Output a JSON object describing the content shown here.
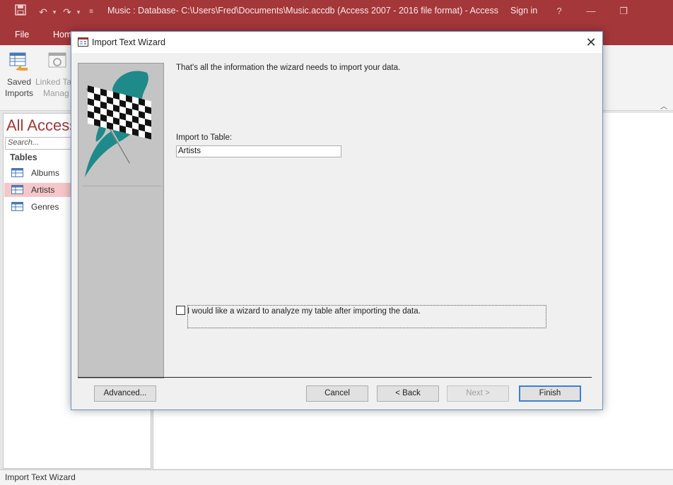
{
  "app": {
    "window_title": "Music : Database- C:\\Users\\Fred\\Documents\\Music.accdb (Access 2007 - 2016 file format) - Access",
    "sign_in": "Sign in",
    "help": "?",
    "brand_color": "#a4373a"
  },
  "ribbon": {
    "tabs": [
      "File",
      "Home"
    ],
    "saved_imports": "Saved\nImports",
    "saved_imports_l1": "Saved",
    "saved_imports_l2": "Imports",
    "linked_l1": "Linked Ta",
    "linked_l2": "Manag"
  },
  "nav": {
    "title": "All Access",
    "search_placeholder": "Search...",
    "group": "Tables",
    "items": [
      {
        "label": "Albums",
        "selected": false
      },
      {
        "label": "Artists",
        "selected": true
      },
      {
        "label": "Genres",
        "selected": false
      }
    ]
  },
  "status": {
    "text": "Import Text Wizard"
  },
  "dialog": {
    "title": "Import Text Wizard",
    "message": "That's all the information the wizard needs to import your data.",
    "import_label": "Import to Table:",
    "import_value": "Artists",
    "analyze_checkbox_label": "I would like a wizard to analyze my table after importing the data.",
    "analyze_checked": false,
    "buttons": {
      "advanced": "Advanced...",
      "cancel": "Cancel",
      "back": "< Back",
      "next": "Next >",
      "finish": "Finish"
    },
    "flag_accent": "#1e8a8a"
  }
}
